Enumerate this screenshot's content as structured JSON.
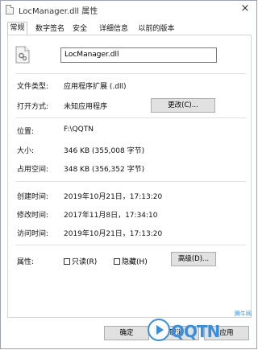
{
  "window": {
    "title": "LocManager.dll 属性",
    "close_glyph": "×"
  },
  "tabs": [
    {
      "label": "常规",
      "active": true
    },
    {
      "label": "数字签名",
      "active": false
    },
    {
      "label": "安全",
      "active": false
    },
    {
      "label": "详细信息",
      "active": false
    },
    {
      "label": "以前的版本",
      "active": false
    }
  ],
  "general": {
    "file_name": "LocManager.dll",
    "file_type_label": "文件类型:",
    "file_type_value": "应用程序扩展 (.dll)",
    "open_with_label": "打开方式:",
    "open_with_value": "未知应用程序",
    "change_button": "更改(C)...",
    "location_label": "位置:",
    "location_value": "F:\\QQTN",
    "size_label": "大小:",
    "size_value": "346 KB (355,008 字节)",
    "size_on_disk_label": "占用空间:",
    "size_on_disk_value": "348 KB (356,352 字节)",
    "created_label": "创建时间:",
    "created_value": "2019年10月21日，17:13:20",
    "modified_label": "修改时间:",
    "modified_value": "2017年11月8日，17:34:10",
    "accessed_label": "访问时间:",
    "accessed_value": "2019年10月21日，17:13:20",
    "attributes_label": "属性:",
    "readonly_label": "只读(R)",
    "readonly_checked": false,
    "hidden_label": "隐藏(H)",
    "hidden_checked": false,
    "advanced_button": "高级(D)..."
  },
  "footer": {
    "ok_button": "确定",
    "cancel_button": "取消",
    "apply_button": "应用"
  },
  "watermark": {
    "text": "QQTN",
    "small_text": "腾牛网",
    "color": "#3b8fd9"
  },
  "icons": {
    "title": "dll-file-icon",
    "file": "dll-gear-file-icon",
    "close": "close-icon"
  }
}
